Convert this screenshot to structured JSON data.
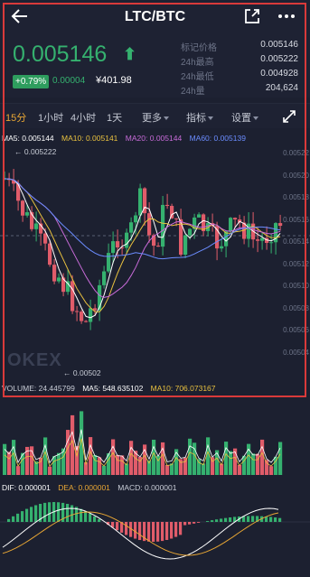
{
  "header": {
    "title": "LTC/BTC"
  },
  "ticker": {
    "last_price": "0.005146",
    "change_pct": "+0.79%",
    "change_abs": "0.00004",
    "cny_price": "¥401.98"
  },
  "stats": [
    {
      "label": "标记价格",
      "value": "0.005146"
    },
    {
      "label": "24h最高",
      "value": "0.005222"
    },
    {
      "label": "24h最低",
      "value": "0.004928"
    },
    {
      "label": "24h量",
      "value": "204,624"
    }
  ],
  "tabs": [
    {
      "label": "15分",
      "active": true
    },
    {
      "label": "1小时"
    },
    {
      "label": "4小时"
    },
    {
      "label": "1天"
    },
    {
      "label": "更多"
    },
    {
      "label": "指标"
    },
    {
      "label": "设置"
    }
  ],
  "ma": {
    "ma5": "MA5: 0.005144",
    "ma10": "MA10: 0.005141",
    "ma20": "MA20: 0.005144",
    "ma60": "MA60: 0.005139"
  },
  "axis": [
    "0.00522",
    "0.00520",
    "0.00518",
    "0.00516",
    "0.00514",
    "0.00512",
    "0.00510",
    "0.00508",
    "0.00506",
    "0.00504"
  ],
  "high_marker": "0.005222",
  "low_marker": "0.00502",
  "watermark": "OKEX",
  "volume": {
    "vol": "VOLUME: 24.445799",
    "ma5": "MA5: 548.635102",
    "ma10": "MA10: 706.073167"
  },
  "macd": {
    "dif": "DIF: 0.000001",
    "dea": "DEA: 0.000001",
    "macd": "MACD: 0.000001"
  },
  "colors": {
    "up": "#35b16f",
    "down": "#e05c6a",
    "ma5": "#ffffff",
    "ma10": "#e8c13f",
    "ma20": "#c86bd9",
    "ma60": "#6b8cff",
    "dea": "#e8a634"
  },
  "icons": [
    "back-arrow-icon",
    "share-icon",
    "more-icon",
    "fullscreen-icon",
    "up-arrow-icon"
  ]
}
